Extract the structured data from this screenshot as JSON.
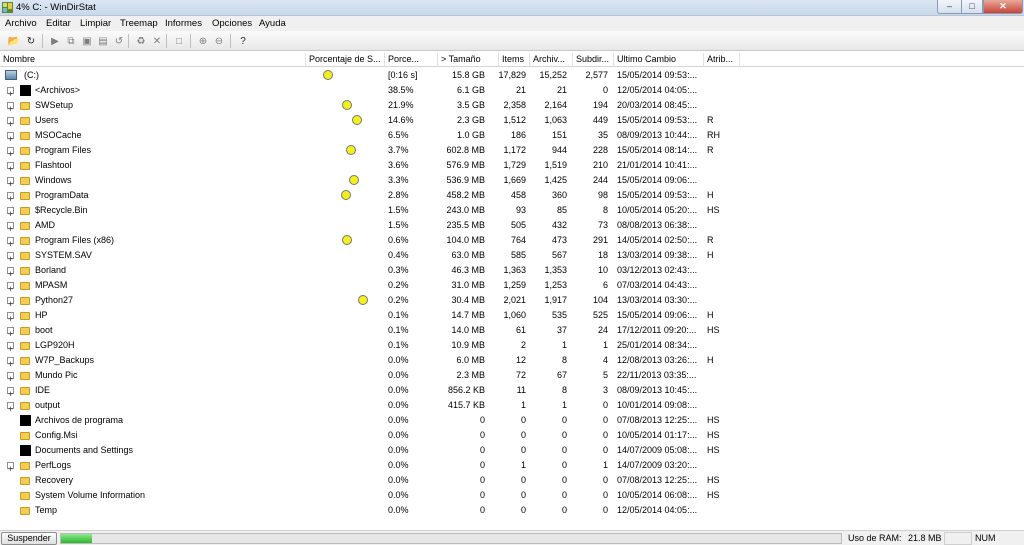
{
  "window": {
    "title": "4% C: - WinDirStat",
    "min": "‒",
    "max": "□",
    "close": "✕"
  },
  "menu": [
    "Archivo",
    "Editar",
    "Limpiar",
    "Treemap",
    "Informes",
    "Opciones",
    "Ayuda"
  ],
  "toolbar": [
    {
      "name": "open-icon",
      "glyph": "📂",
      "enabled": true
    },
    {
      "name": "refresh-all-icon",
      "glyph": "↻",
      "enabled": true
    },
    {
      "name": "play-icon",
      "glyph": "▶",
      "enabled": false
    },
    {
      "name": "copy-icon",
      "glyph": "⧉",
      "enabled": false
    },
    {
      "name": "explorer-icon",
      "glyph": "▣",
      "enabled": false
    },
    {
      "name": "command-prompt-icon",
      "glyph": "▤",
      "enabled": false
    },
    {
      "name": "refresh-icon",
      "glyph": "↺",
      "enabled": false
    },
    {
      "name": "recycle-icon",
      "glyph": "♻",
      "enabled": false
    },
    {
      "name": "delete-icon",
      "glyph": "✕",
      "enabled": false
    },
    {
      "name": "properties-icon",
      "glyph": "□",
      "enabled": false
    },
    {
      "name": "zoom-in-icon",
      "glyph": "⊕",
      "enabled": false
    },
    {
      "name": "zoom-out-icon",
      "glyph": "⊖",
      "enabled": false
    },
    {
      "name": "help-icon",
      "glyph": "?",
      "enabled": true
    }
  ],
  "columns": [
    {
      "label": "Nombre",
      "align": "left"
    },
    {
      "label": "Porcentaje de S...",
      "align": "left"
    },
    {
      "label": "Porce...",
      "align": "left"
    },
    {
      "label": "> Tamaño",
      "align": "left"
    },
    {
      "label": "Items",
      "align": "left"
    },
    {
      "label": "Archiv...",
      "align": "left"
    },
    {
      "label": "Subdir...",
      "align": "left"
    },
    {
      "label": "Ultimo Cambio",
      "align": "left"
    },
    {
      "label": "Atrib...",
      "align": "left"
    }
  ],
  "root": {
    "name": "(C:)",
    "percent": "[0:16 s]",
    "size": "15.8 GB",
    "items": "17,829",
    "files": "15,252",
    "subdirs": "2,577",
    "modified": "15/05/2014  09:53:...",
    "attrs": "",
    "pie": true
  },
  "rows": [
    {
      "name": "<Archivos>",
      "icon": "files",
      "expand": true,
      "pie": false,
      "percent": "38.5%",
      "size": "6.1 GB",
      "items": "21",
      "files": "21",
      "subdirs": "0",
      "modified": "12/05/2014  04:05:...",
      "attrs": ""
    },
    {
      "name": "SWSetup",
      "icon": "folder",
      "expand": true,
      "pie": true,
      "percent": "21.9%",
      "size": "3.5 GB",
      "items": "2,358",
      "files": "2,164",
      "subdirs": "194",
      "modified": "20/03/2014  08:45:...",
      "attrs": ""
    },
    {
      "name": "Users",
      "icon": "folder",
      "expand": true,
      "pie": true,
      "percent": "14.6%",
      "size": "2.3 GB",
      "items": "1,512",
      "files": "1,063",
      "subdirs": "449",
      "modified": "15/05/2014  09:53:...",
      "attrs": "R"
    },
    {
      "name": "MSOCache",
      "icon": "folder",
      "expand": true,
      "pie": false,
      "percent": "6.5%",
      "size": "1.0 GB",
      "items": "186",
      "files": "151",
      "subdirs": "35",
      "modified": "08/09/2013  10:44:...",
      "attrs": "RH"
    },
    {
      "name": "Program Files",
      "icon": "folder",
      "expand": true,
      "pie": true,
      "percent": "3.7%",
      "size": "602.8 MB",
      "items": "1,172",
      "files": "944",
      "subdirs": "228",
      "modified": "15/05/2014  08:14:...",
      "attrs": "R"
    },
    {
      "name": "Flashtool",
      "icon": "folder",
      "expand": true,
      "pie": false,
      "percent": "3.6%",
      "size": "576.9 MB",
      "items": "1,729",
      "files": "1,519",
      "subdirs": "210",
      "modified": "21/01/2014  10:41:...",
      "attrs": ""
    },
    {
      "name": "Windows",
      "icon": "folder",
      "expand": true,
      "pie": true,
      "percent": "3.3%",
      "size": "536.9 MB",
      "items": "1,669",
      "files": "1,425",
      "subdirs": "244",
      "modified": "15/05/2014  09:06:...",
      "attrs": ""
    },
    {
      "name": "ProgramData",
      "icon": "folder",
      "expand": true,
      "pie": true,
      "percent": "2.8%",
      "size": "458.2 MB",
      "items": "458",
      "files": "360",
      "subdirs": "98",
      "modified": "15/05/2014  09:53:...",
      "attrs": "H"
    },
    {
      "name": "$Recycle.Bin",
      "icon": "folder",
      "expand": true,
      "pie": false,
      "percent": "1.5%",
      "size": "243.0 MB",
      "items": "93",
      "files": "85",
      "subdirs": "8",
      "modified": "10/05/2014  05:20:...",
      "attrs": "HS"
    },
    {
      "name": "AMD",
      "icon": "folder",
      "expand": true,
      "pie": false,
      "percent": "1.5%",
      "size": "235.5 MB",
      "items": "505",
      "files": "432",
      "subdirs": "73",
      "modified": "08/08/2013  06:38:...",
      "attrs": ""
    },
    {
      "name": "Program Files (x86)",
      "icon": "folder",
      "expand": true,
      "pie": true,
      "percent": "0.6%",
      "size": "104.0 MB",
      "items": "764",
      "files": "473",
      "subdirs": "291",
      "modified": "14/05/2014  02:50:...",
      "attrs": "R"
    },
    {
      "name": "SYSTEM.SAV",
      "icon": "folder",
      "expand": true,
      "pie": false,
      "percent": "0.4%",
      "size": "63.0 MB",
      "items": "585",
      "files": "567",
      "subdirs": "18",
      "modified": "13/03/2014  09:38:...",
      "attrs": "H"
    },
    {
      "name": "Borland",
      "icon": "folder",
      "expand": true,
      "pie": false,
      "percent": "0.3%",
      "size": "46.3 MB",
      "items": "1,363",
      "files": "1,353",
      "subdirs": "10",
      "modified": "03/12/2013  02:43:...",
      "attrs": ""
    },
    {
      "name": "MPASM",
      "icon": "folder",
      "expand": true,
      "pie": false,
      "percent": "0.2%",
      "size": "31.0 MB",
      "items": "1,259",
      "files": "1,253",
      "subdirs": "6",
      "modified": "07/03/2014  04:43:...",
      "attrs": ""
    },
    {
      "name": "Python27",
      "icon": "folder",
      "expand": true,
      "pie": true,
      "percent": "0.2%",
      "size": "30.4 MB",
      "items": "2,021",
      "files": "1,917",
      "subdirs": "104",
      "modified": "13/03/2014  03:30:...",
      "attrs": ""
    },
    {
      "name": "HP",
      "icon": "folder",
      "expand": true,
      "pie": false,
      "percent": "0.1%",
      "size": "14.7 MB",
      "items": "1,060",
      "files": "535",
      "subdirs": "525",
      "modified": "15/05/2014  09:06:...",
      "attrs": "H"
    },
    {
      "name": "boot",
      "icon": "folder",
      "expand": true,
      "pie": false,
      "percent": "0.1%",
      "size": "14.0 MB",
      "items": "61",
      "files": "37",
      "subdirs": "24",
      "modified": "17/12/2011  09:20:...",
      "attrs": "HS"
    },
    {
      "name": "LGP920H",
      "icon": "folder",
      "expand": true,
      "pie": false,
      "percent": "0.1%",
      "size": "10.9 MB",
      "items": "2",
      "files": "1",
      "subdirs": "1",
      "modified": "25/01/2014  08:34:...",
      "attrs": ""
    },
    {
      "name": "W7P_Backups",
      "icon": "folder",
      "expand": true,
      "pie": false,
      "percent": "0.0%",
      "size": "6.0 MB",
      "items": "12",
      "files": "8",
      "subdirs": "4",
      "modified": "12/08/2013  03:26:...",
      "attrs": "H"
    },
    {
      "name": "Mundo Pic",
      "icon": "folder",
      "expand": true,
      "pie": false,
      "percent": "0.0%",
      "size": "2.3 MB",
      "items": "72",
      "files": "67",
      "subdirs": "5",
      "modified": "22/11/2013  03:35:...",
      "attrs": ""
    },
    {
      "name": "IDE",
      "icon": "folder",
      "expand": true,
      "pie": false,
      "percent": "0.0%",
      "size": "856.2 KB",
      "items": "11",
      "files": "8",
      "subdirs": "3",
      "modified": "08/09/2013  10:45:...",
      "attrs": ""
    },
    {
      "name": "output",
      "icon": "folder",
      "expand": true,
      "pie": false,
      "percent": "0.0%",
      "size": "415.7 KB",
      "items": "1",
      "files": "1",
      "subdirs": "0",
      "modified": "10/01/2014  09:08:...",
      "attrs": ""
    },
    {
      "name": "Archivos de programa",
      "icon": "black",
      "expand": false,
      "pie": false,
      "percent": "0.0%",
      "size": "0",
      "items": "0",
      "files": "0",
      "subdirs": "0",
      "modified": "07/08/2013  12:25:...",
      "attrs": "HS"
    },
    {
      "name": "Config.Msi",
      "icon": "folder",
      "expand": false,
      "pie": false,
      "percent": "0.0%",
      "size": "0",
      "items": "0",
      "files": "0",
      "subdirs": "0",
      "modified": "10/05/2014  01:17:...",
      "attrs": "HS"
    },
    {
      "name": "Documents and Settings",
      "icon": "black",
      "expand": false,
      "pie": false,
      "percent": "0.0%",
      "size": "0",
      "items": "0",
      "files": "0",
      "subdirs": "0",
      "modified": "14/07/2009  05:08:...",
      "attrs": "HS"
    },
    {
      "name": "PerfLogs",
      "icon": "folder",
      "expand": true,
      "pie": false,
      "percent": "0.0%",
      "size": "0",
      "items": "1",
      "files": "0",
      "subdirs": "1",
      "modified": "14/07/2009  03:20:...",
      "attrs": ""
    },
    {
      "name": "Recovery",
      "icon": "folder",
      "expand": false,
      "pie": false,
      "percent": "0.0%",
      "size": "0",
      "items": "0",
      "files": "0",
      "subdirs": "0",
      "modified": "07/08/2013  12:25:...",
      "attrs": "HS"
    },
    {
      "name": "System Volume Information",
      "icon": "folder",
      "expand": false,
      "pie": false,
      "percent": "0.0%",
      "size": "0",
      "items": "0",
      "files": "0",
      "subdirs": "0",
      "modified": "10/05/2014  06:08:...",
      "attrs": "HS"
    },
    {
      "name": "Temp",
      "icon": "folder",
      "expand": false,
      "pie": false,
      "percent": "0.0%",
      "size": "0",
      "items": "0",
      "files": "0",
      "subdirs": "0",
      "modified": "12/05/2014  04:05:...",
      "attrs": ""
    }
  ],
  "status": {
    "suspend": "Suspender",
    "progress_percent": 4,
    "ram_label": "Uso de RAM:",
    "ram_value": "21.8 MB",
    "num": "NUM"
  },
  "colors": {
    "pie_fill": "#f3ef1c",
    "folder": "#f4cd57",
    "progress": "#2fb52f"
  }
}
